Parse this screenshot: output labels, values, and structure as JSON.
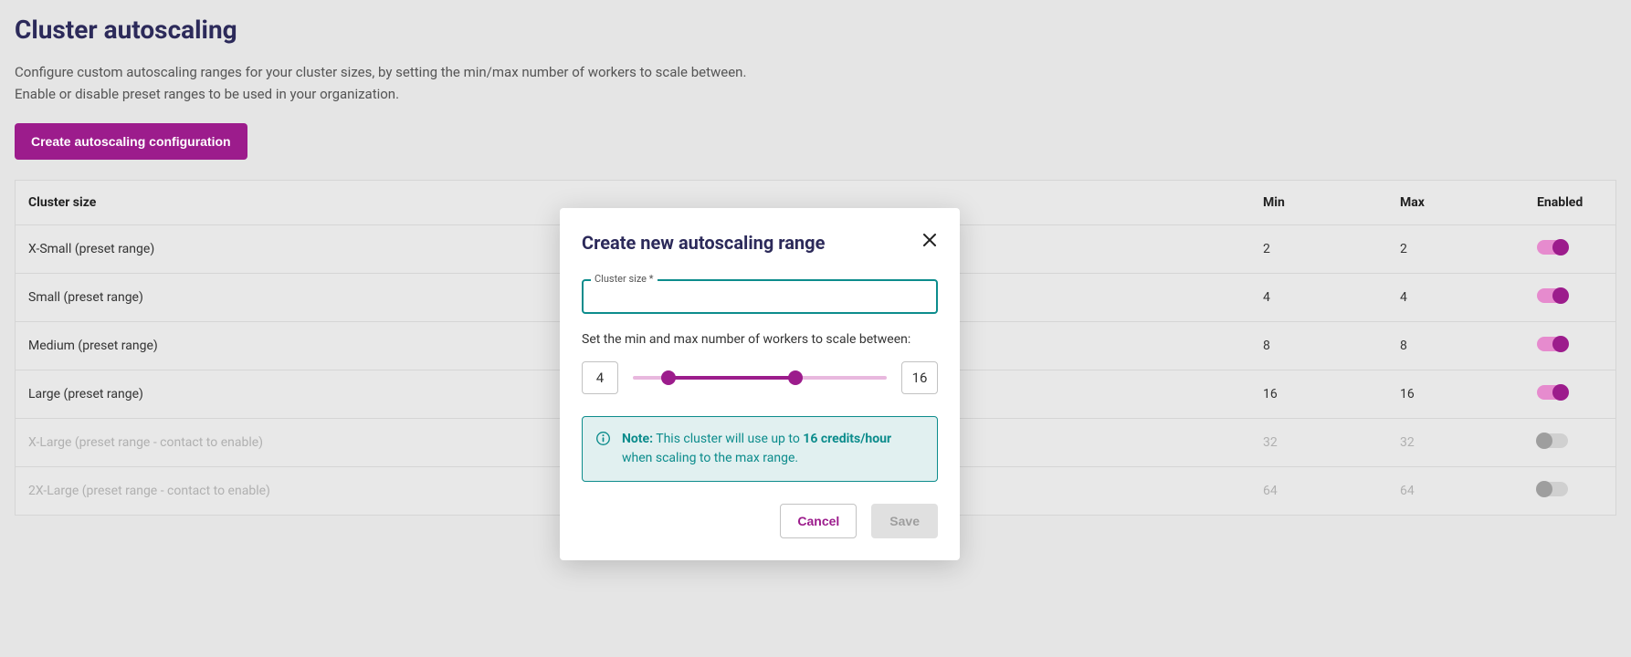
{
  "page": {
    "title": "Cluster autoscaling",
    "desc_line1": "Configure custom autoscaling ranges for your cluster sizes, by setting the min/max number of workers to scale between.",
    "desc_line2": "Enable or disable preset ranges to be used in your organization.",
    "create_button": "Create autoscaling configuration"
  },
  "table": {
    "headers": {
      "size": "Cluster size",
      "min": "Min",
      "max": "Max",
      "enabled": "Enabled"
    },
    "rows": [
      {
        "size": "X-Small (preset range)",
        "min": "2",
        "max": "2",
        "enabled": true,
        "greyed": false
      },
      {
        "size": "Small (preset range)",
        "min": "4",
        "max": "4",
        "enabled": true,
        "greyed": false
      },
      {
        "size": "Medium (preset range)",
        "min": "8",
        "max": "8",
        "enabled": true,
        "greyed": false
      },
      {
        "size": "Large (preset range)",
        "min": "16",
        "max": "16",
        "enabled": true,
        "greyed": false
      },
      {
        "size": "X-Large (preset range - contact to enable)",
        "min": "32",
        "max": "32",
        "enabled": false,
        "greyed": true
      },
      {
        "size": "2X-Large (preset range - contact to enable)",
        "min": "64",
        "max": "64",
        "enabled": false,
        "greyed": true
      }
    ]
  },
  "modal": {
    "title": "Create new autoscaling range",
    "field_label": "Cluster size *",
    "field_value": "",
    "set_label": "Set the min and max number of workers to scale between:",
    "min_value": "4",
    "max_value": "16",
    "note": {
      "label": "Note:",
      "text_before": "This cluster will use up to ",
      "credits": "16 credits/hour",
      "text_after": " when scaling to the max range."
    },
    "cancel": "Cancel",
    "save": "Save"
  }
}
